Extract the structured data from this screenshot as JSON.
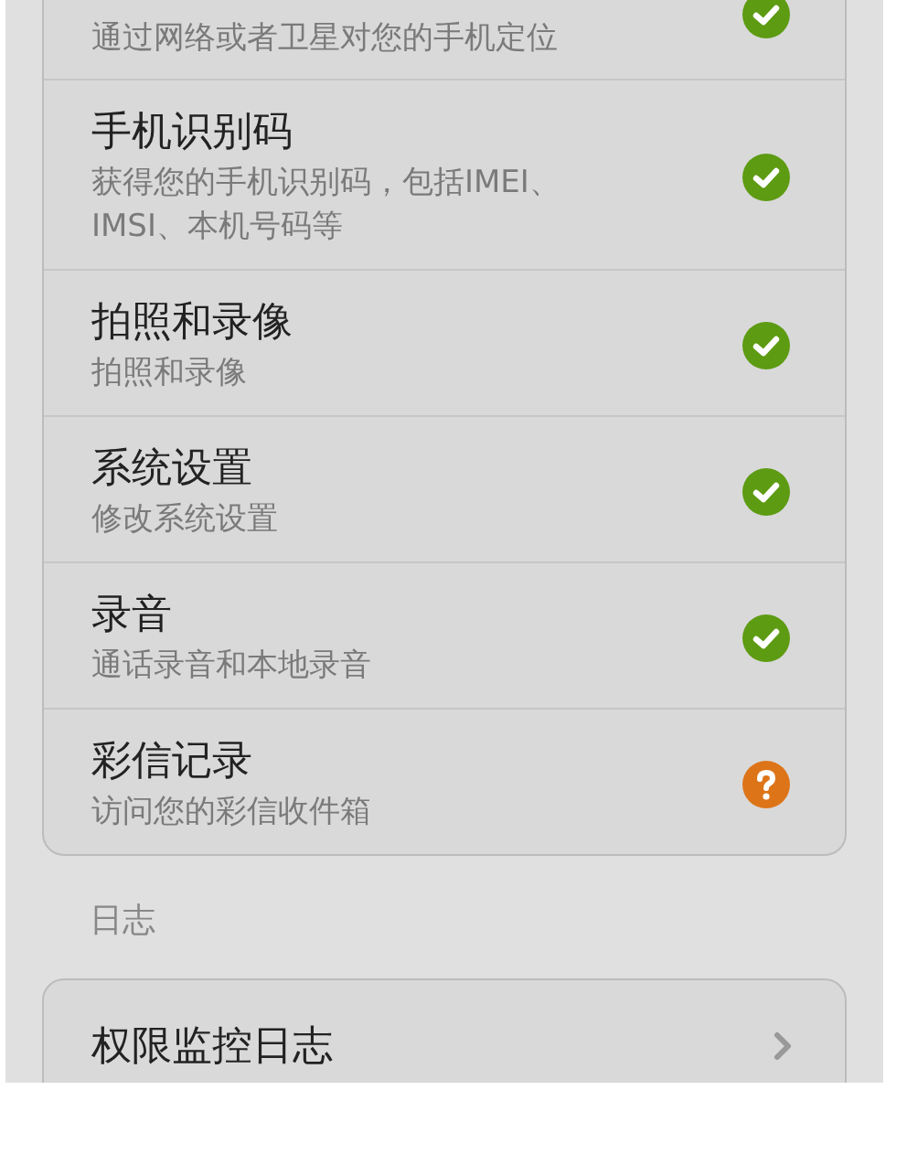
{
  "permissions": [
    {
      "description": "通过网络或者卫星对您的手机定位",
      "kind": "allowed"
    },
    {
      "title": "手机识别码",
      "description": "获得您的手机识别码，包括IMEI、IMSI、本机号码等",
      "kind": "allowed"
    },
    {
      "title": "拍照和录像",
      "description": "拍照和录像",
      "kind": "allowed"
    },
    {
      "title": "系统设置",
      "description": "修改系统设置",
      "kind": "allowed"
    },
    {
      "title": "录音",
      "description": "通话录音和本地录音",
      "kind": "allowed"
    },
    {
      "title": "彩信记录",
      "description": "访问您的彩信收件箱",
      "kind": "ask"
    }
  ],
  "log_section": {
    "label": "日志",
    "items": [
      {
        "title": "权限监控日志"
      }
    ]
  }
}
